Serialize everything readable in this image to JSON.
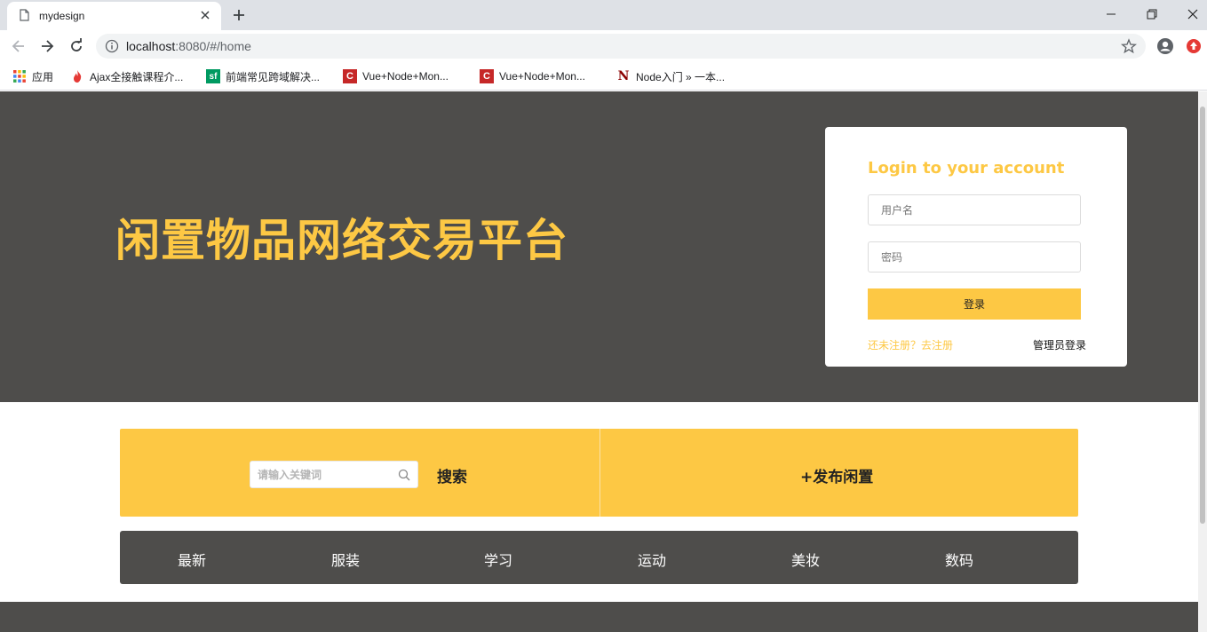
{
  "browser": {
    "tab_title": "mydesign",
    "url_host": "localhost",
    "url_rest": ":8080/#/home",
    "bookmarks": [
      {
        "label": "应用",
        "icon": "apps-grid-icon"
      },
      {
        "label": "Ajax全接触课程介...",
        "icon": "flame-icon"
      },
      {
        "label": "前端常见跨域解决...",
        "icon": "sf-icon"
      },
      {
        "label": "Vue+Node+Mon...",
        "icon": "c-icon"
      },
      {
        "label": "Vue+Node+Mon...",
        "icon": "c-icon"
      },
      {
        "label": "Node入门 » 一本...",
        "icon": "n-icon"
      }
    ]
  },
  "hero": {
    "site_title": "闲置物品网络交易平台"
  },
  "login": {
    "heading": "Login to your account",
    "username_placeholder": "用户名",
    "password_placeholder": "密码",
    "submit_label": "登录",
    "register_link": "还未注册？去注册",
    "admin_link": "管理员登录"
  },
  "actions": {
    "search_placeholder": "请输入关键词",
    "search_label": "搜索",
    "publish_label": "+发布闲置"
  },
  "categories": [
    "最新",
    "服装",
    "学习",
    "运动",
    "美妆",
    "数码"
  ],
  "colors": {
    "accent": "#fdc844",
    "dark": "#4e4d4b"
  }
}
